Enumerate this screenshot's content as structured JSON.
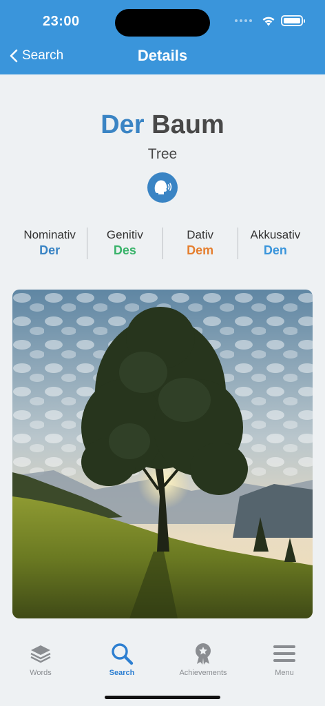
{
  "status": {
    "time": "23:00"
  },
  "nav": {
    "back_label": "Search",
    "title": "Details"
  },
  "word": {
    "article": "Der",
    "noun": "Baum",
    "translation": "Tree"
  },
  "cases": [
    {
      "label": "Nominativ",
      "value": "Der",
      "color": "#3a84c4"
    },
    {
      "label": "Genitiv",
      "value": "Des",
      "color": "#39b36a"
    },
    {
      "label": "Dativ",
      "value": "Dem",
      "color": "#e57f2f"
    },
    {
      "label": "Akkusativ",
      "value": "Den",
      "color": "#3a95db"
    }
  ],
  "image": {
    "subject": "lone tree on grassy hillside at sunset"
  },
  "tabs": [
    {
      "label": "Words",
      "icon": "layers-icon",
      "active": false
    },
    {
      "label": "Search",
      "icon": "search-icon",
      "active": true
    },
    {
      "label": "Achievements",
      "icon": "medal-icon",
      "active": false
    },
    {
      "label": "Menu",
      "icon": "menu-icon",
      "active": false
    }
  ],
  "colors": {
    "header": "#3a95db",
    "accent": "#3a84c4",
    "active_tab": "#2d7fd1",
    "inactive_tab": "#8a8d91"
  }
}
